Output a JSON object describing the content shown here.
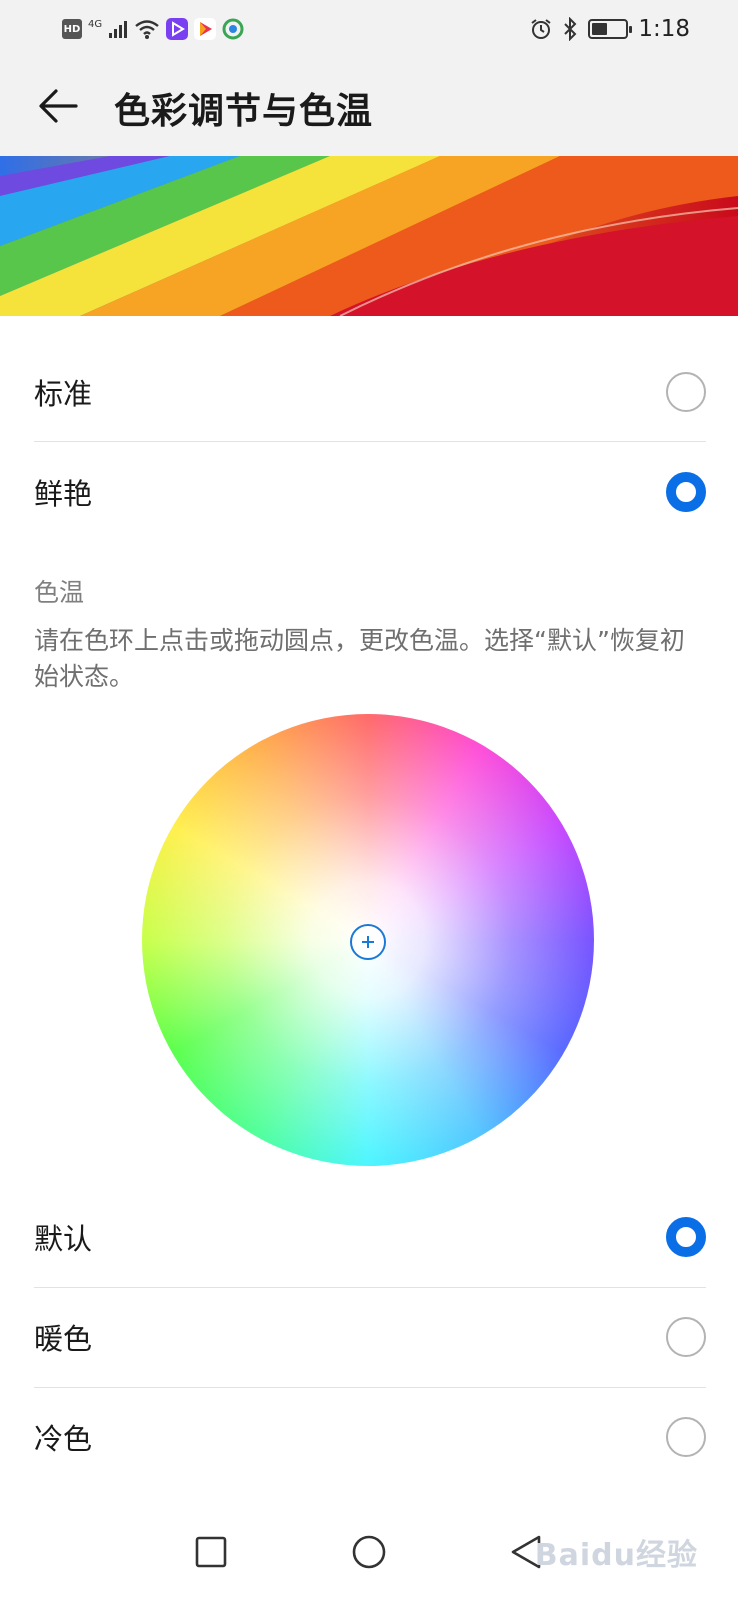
{
  "status_bar": {
    "hd_badge": "HD",
    "network": "4G",
    "time": "1:18",
    "battery_level": 0.4,
    "icons": [
      "hd-icon",
      "signal-icon",
      "wifi-icon",
      "app-video-icon",
      "app-play-icon",
      "app-camera-icon",
      "alarm-icon",
      "bluetooth-icon",
      "battery-icon"
    ]
  },
  "header": {
    "title": "色彩调节与色温",
    "back_icon": "arrow-left-icon"
  },
  "color_mode": {
    "options": [
      {
        "label": "标准",
        "selected": false
      },
      {
        "label": "鲜艳",
        "selected": true
      }
    ]
  },
  "color_temp": {
    "title": "色温",
    "description": "请在色环上点击或拖动圆点，更改色温。选择“默认”恢复初始状态。",
    "handle_icon": "plus-icon",
    "options": [
      {
        "label": "默认",
        "selected": true
      },
      {
        "label": "暖色",
        "selected": false
      },
      {
        "label": "冷色",
        "selected": false
      }
    ]
  },
  "nav_bar": {
    "icons": [
      "recent-apps-icon",
      "home-icon",
      "back-icon"
    ]
  },
  "watermark": "Baidu经验",
  "colors": {
    "accent": "#0a6ee6",
    "header_bg": "#f2f2f2"
  }
}
